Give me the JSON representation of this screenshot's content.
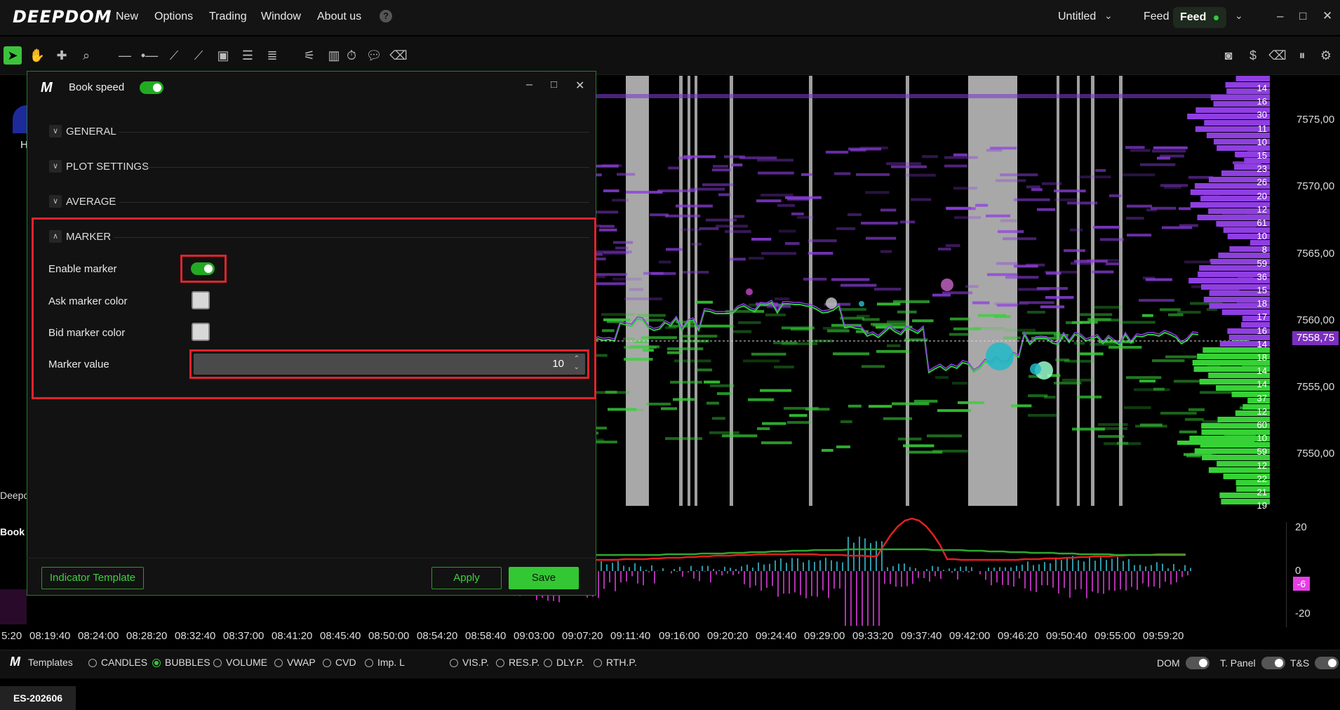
{
  "app": {
    "logo": "DEEPDOM"
  },
  "menu": {
    "items": [
      "New",
      "Options",
      "Trading",
      "Window",
      "About us"
    ],
    "help_label": "?"
  },
  "workspace": {
    "title": "Untitled",
    "feed_label": "Feed",
    "feed_status": "Feed"
  },
  "window_controls": {
    "minimize": "–",
    "maximize": "□",
    "close": "✕"
  },
  "toolbar": {
    "icons": [
      "cursor-icon",
      "hand-icon",
      "crosshair-icon",
      "zoom-icon",
      "horizontal-line-icon",
      "ray-icon",
      "trend-line-icon",
      "ruler-icon",
      "rectangle-icon",
      "fib-icon",
      "channel-icon",
      "settings-sliders-icon",
      "volume-profile-icon",
      "timer-icon",
      "comment-icon",
      "eraser-icon"
    ],
    "right_icons": [
      "camera-icon",
      "dollar-icon",
      "eraser-icon",
      "pause-icon",
      "gear-icon"
    ]
  },
  "chart": {
    "price_labels": [
      "7575,00",
      "7570,00",
      "7565,00",
      "7560,00",
      "7555,00",
      "7550,00"
    ],
    "current_price": "7558,75",
    "volume_numbers": [
      "14",
      "16",
      "30",
      "11",
      "10",
      "15",
      "23",
      "26",
      "20",
      "12",
      "61",
      "10",
      "8",
      "59",
      "36",
      "15",
      "18",
      "17",
      "16",
      "14",
      "18",
      "14",
      "14",
      "37",
      "12",
      "60",
      "10",
      "59",
      "12",
      "22",
      "21",
      "19"
    ],
    "left_labels": {
      "h": "H",
      "deepo": "Deepo",
      "book": "Book"
    },
    "oscillator": {
      "labels": [
        "20",
        "0",
        "-20"
      ],
      "current": "-6"
    },
    "time_labels": [
      "5:20",
      "08:19:40",
      "08:24:00",
      "08:28:20",
      "08:32:40",
      "08:37:00",
      "08:41:20",
      "08:45:40",
      "08:50:00",
      "08:54:20",
      "08:58:40",
      "09:03:00",
      "09:07:20",
      "09:11:40",
      "09:16:00",
      "09:20:20",
      "09:24:40",
      "09:29:00",
      "09:33:20",
      "09:37:40",
      "09:42:00",
      "09:46:20",
      "09:50:40",
      "09:55:00",
      "09:59:20"
    ],
    "colors": {
      "bid": "#37d137",
      "ask": "#8f3fe0",
      "price_line": "#2ecc40",
      "highlight": "#a8a8a8"
    }
  },
  "dialog": {
    "title": "Book speed",
    "enabled": true,
    "sections": {
      "general": "GENERAL",
      "plot": "PLOT SETTINGS",
      "average": "AVERAGE",
      "marker": "MARKER"
    },
    "marker": {
      "enable_label": "Enable marker",
      "enable_value": true,
      "ask_color_label": "Ask marker color",
      "ask_color": "#d8d8d8",
      "bid_color_label": "Bid marker color",
      "bid_color": "#d8d8d8",
      "value_label": "Marker value",
      "value": "10"
    },
    "buttons": {
      "template": "Indicator Template",
      "apply": "Apply",
      "save": "Save"
    }
  },
  "bottombar": {
    "templates_label": "Templates",
    "options": [
      "CANDLES",
      "BUBBLES",
      "VOLUME",
      "VWAP",
      "CVD",
      "Imp. L"
    ],
    "selected_option": "BUBBLES",
    "profiles": [
      "VIS.P.",
      "RES.P.",
      "DLY.P.",
      "RTH.P."
    ],
    "toggles": [
      "DOM",
      "T. Panel",
      "T&S"
    ]
  },
  "symbol_tab": "ES-202606"
}
